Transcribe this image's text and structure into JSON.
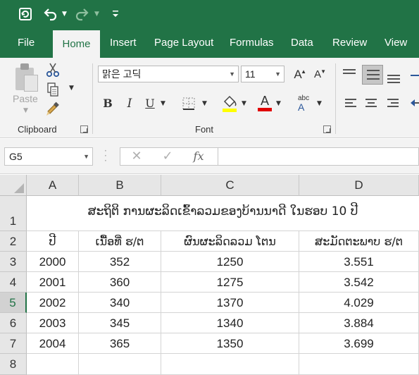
{
  "qat": {
    "autosave_icon": "autosave-icon",
    "undo_icon": "undo-icon",
    "redo_icon": "redo-icon",
    "customize_icon": "customize-qat-icon"
  },
  "tabs": [
    {
      "label": "File",
      "active": false
    },
    {
      "label": "Home",
      "active": true
    },
    {
      "label": "Insert",
      "active": false
    },
    {
      "label": "Page Layout",
      "active": false
    },
    {
      "label": "Formulas",
      "active": false
    },
    {
      "label": "Data",
      "active": false
    },
    {
      "label": "Review",
      "active": false
    },
    {
      "label": "View",
      "active": false
    }
  ],
  "ribbon": {
    "clipboard": {
      "paste_label": "Paste",
      "group_label": "Clipboard"
    },
    "font": {
      "font_name": "맑은 고딕",
      "font_size": "11",
      "group_label": "Font",
      "bold": "B",
      "italic": "I",
      "underline": "U",
      "grow": "A",
      "shrink": "A",
      "font_color_letter": "A",
      "phonetic": "abc"
    }
  },
  "formula_bar": {
    "name_box": "G5",
    "fx_label": "fx",
    "formula": ""
  },
  "columns": [
    "A",
    "B",
    "C",
    "D"
  ],
  "rows": [
    "1",
    "2",
    "3",
    "4",
    "5",
    "6",
    "7",
    "8"
  ],
  "selected_row": "5",
  "sheet": {
    "title": "ສະຖິຕິ ການຜະລິດເຂົ້າລວມຂອງບ້ານນາດີ ໃນຮອບ 10 ປີ",
    "headers": [
      "ປີ",
      "ເນື້ອທີ່ ຮ/ຕ",
      "ຜົນຜະລິດລວມ ໂຕນ",
      "ສະມັດຕະພາບ ຮ/ຕ"
    ],
    "data": [
      [
        "2000",
        "352",
        "1250",
        "3.551"
      ],
      [
        "2001",
        "360",
        "1275",
        "3.542"
      ],
      [
        "2002",
        "340",
        "1370",
        "4.029"
      ],
      [
        "2003",
        "345",
        "1340",
        "3.884"
      ],
      [
        "2004",
        "365",
        "1350",
        "3.699"
      ]
    ]
  },
  "colors": {
    "excel_green": "#217346",
    "fill_highlight": "#ffff00",
    "font_color": "#ff0000"
  }
}
